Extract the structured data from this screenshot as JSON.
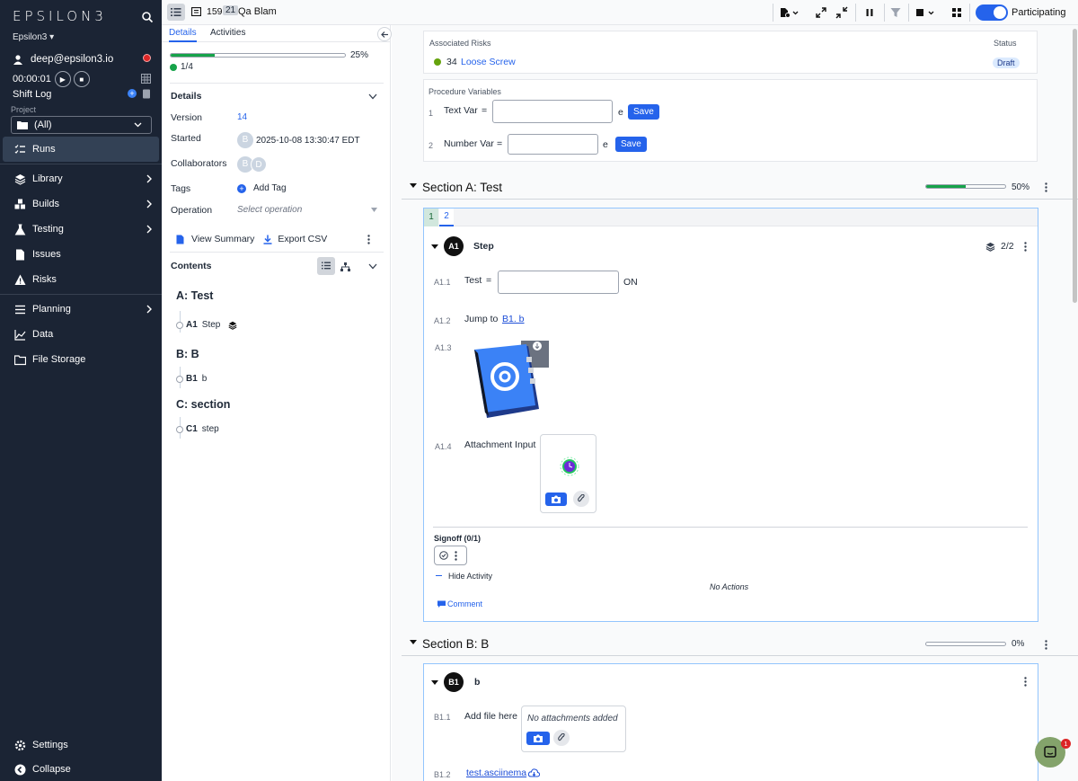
{
  "brand": {
    "logo": "EPSILON3",
    "org": "Epsilon3 ▾"
  },
  "user": {
    "email": "deep@epsilon3.io"
  },
  "timer": {
    "value": "00:00:01"
  },
  "shift_log": {
    "label": "Shift Log"
  },
  "project": {
    "label": "Project",
    "selected": "(All)"
  },
  "nav": {
    "items": [
      {
        "label": "Runs",
        "icon": "runs-list-icon",
        "active": true
      },
      {
        "label": "Library",
        "icon": "layers-icon"
      },
      {
        "label": "Builds",
        "icon": "boxes-icon"
      },
      {
        "label": "Testing",
        "icon": "flask-icon"
      },
      {
        "label": "Issues",
        "icon": "document-icon"
      },
      {
        "label": "Risks",
        "icon": "warning-icon"
      },
      {
        "label": "Planning",
        "icon": "planning-list-icon"
      },
      {
        "label": "Data",
        "icon": "line-chart-icon"
      },
      {
        "label": "File Storage",
        "icon": "folder-icon"
      }
    ],
    "settings": "Settings",
    "collapse": "Collapse"
  },
  "topbar": {
    "run_id": "159",
    "badge": "21",
    "name": "Qa Blam",
    "participating": "Participating"
  },
  "details_panel": {
    "tabs": [
      "Details",
      "Activities"
    ],
    "progress_pct_label": "25%",
    "progress_fraction": 0.25,
    "progress_count": "1/4",
    "section_title": "Details",
    "version_label": "Version",
    "version_value": "14",
    "started_label": "Started",
    "started_avatar": "B",
    "started_value": "2025-10-08 13:30:47 EDT",
    "collaborators_label": "Collaborators",
    "collaborators": [
      "B",
      "D"
    ],
    "tags_label": "Tags",
    "add_tag": "Add Tag",
    "operation_label": "Operation",
    "operation_placeholder": "Select operation",
    "view_summary": "View Summary",
    "export_csv": "Export CSV",
    "contents_label": "Contents",
    "contents": [
      {
        "section": "A: Test",
        "steps": [
          {
            "key": "A1",
            "name": "Step"
          }
        ]
      },
      {
        "section": "B: B",
        "steps": [
          {
            "key": "B1",
            "name": "b"
          }
        ]
      },
      {
        "section": "C: section",
        "steps": [
          {
            "key": "C1",
            "name": "step"
          }
        ]
      }
    ]
  },
  "risks": {
    "header": "Associated Risks",
    "status_header": "Status",
    "items": [
      {
        "id": "34",
        "name": "Loose Screw",
        "status": "Draft"
      }
    ]
  },
  "variables": {
    "header": "Procedure Variables",
    "items": [
      {
        "index": "1",
        "label": "Text Var",
        "eq": "=",
        "unit": "e",
        "save": "Save"
      },
      {
        "index": "2",
        "label": "Number Var",
        "eq": "=",
        "unit": "e",
        "save": "Save"
      }
    ]
  },
  "section_a": {
    "title": "Section A: Test",
    "pct_label": "50%",
    "progress_fraction": 0.5,
    "tabs": [
      "1",
      "2"
    ],
    "step": {
      "key": "A1",
      "title": "Step",
      "count": "2/2",
      "rows": [
        {
          "id": "A1.1",
          "label": "Test",
          "eq": "=",
          "unit": "ON"
        },
        {
          "id": "A1.2",
          "label": "Jump to",
          "link": "B1. b"
        },
        {
          "id": "A1.3"
        },
        {
          "id": "A1.4",
          "label": "Attachment Input"
        }
      ],
      "signoff": "Signoff (0/1)",
      "hide_activity": "Hide Activity",
      "no_actions": "No Actions",
      "comment": "Comment"
    }
  },
  "section_b": {
    "title": "Section B: B",
    "pct_label": "0%",
    "progress_fraction": 0,
    "step": {
      "key": "B1",
      "title": "b",
      "rows": [
        {
          "id": "B1.1",
          "label": "Add file here",
          "empty": "No attachments added"
        },
        {
          "id": "B1.2",
          "link": "test.asciinema"
        }
      ]
    }
  },
  "chat": {
    "badge": "1"
  },
  "colors": {
    "sidebar": "#1b2434",
    "accent": "#2563eb",
    "success": "#16a34a",
    "danger": "#dc2626"
  }
}
